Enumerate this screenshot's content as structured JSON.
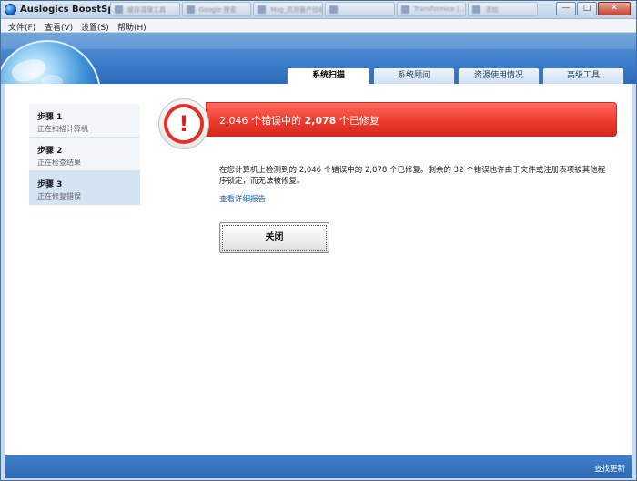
{
  "window": {
    "title": "Auslogics BoostSpeed",
    "background_tabs": [
      "缓存清理工具",
      "Google 搜索",
      "Msg_员测量产验收",
      "",
      "Transformice | ..",
      "添加"
    ]
  },
  "menu": {
    "items": [
      "文件(F)",
      "查看(V)",
      "设置(S)",
      "帮助(H)"
    ]
  },
  "tabs": [
    {
      "label": "系统扫描",
      "active": true
    },
    {
      "label": "系统顾问",
      "active": false
    },
    {
      "label": "资源使用情况",
      "active": false
    },
    {
      "label": "高级工具",
      "active": false
    }
  ],
  "steps": [
    {
      "title": "步骤 1",
      "desc": "正在扫描计算机"
    },
    {
      "title": "步骤 2",
      "desc": "正在检查结果"
    },
    {
      "title": "步骤 3",
      "desc": "正在修复错误"
    }
  ],
  "alert": {
    "count_text": "2,046",
    "mid_text": " 个错误中的 ",
    "fixed_text": "2,078",
    "end_text": " 个已修复"
  },
  "message": "在您计算机上检测到的 2,046 个错误中的 2,078 个已修复。剩余的 32 个错误也许由于文件或注册表项被其他程序锁定，而无法被修复。",
  "report_link": "查看详细报告",
  "close_button": "关闭",
  "footer": {
    "update_link": "查找更新"
  },
  "colors": {
    "accent_blue": "#3d7fcb",
    "alert_red": "#ef3b2f",
    "link_blue": "#1f5fb0"
  }
}
